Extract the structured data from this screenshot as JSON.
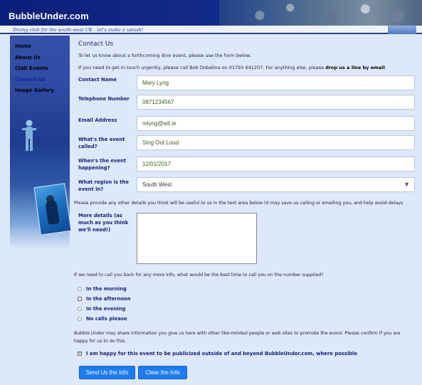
{
  "header": {
    "site_title": "BubbleUnder.com",
    "tagline": "Diving club for the south-west UK - let's make a splash!"
  },
  "sidebar": {
    "items": [
      {
        "label": "Home"
      },
      {
        "label": "About Us"
      },
      {
        "label": "Club Events"
      },
      {
        "label": "Contact Us",
        "active": true
      },
      {
        "label": "Image Gallery"
      }
    ]
  },
  "main": {
    "title": "Contact Us",
    "intro1": "To let us know about a forthcoming dive event, please use the form below.",
    "intro2_pre": "If you need to get in touch urgently, please call Bob Dobalina on 01793 641207. For anything else, please ",
    "intro2_bold": "drop us a line by email",
    "intro2_post": ".",
    "fields": {
      "contact_name": {
        "label": "Contact Name",
        "value": "Mary Lyng"
      },
      "phone": {
        "label": "Telephone Number",
        "value": "0871234567"
      },
      "email": {
        "label": "Email Address",
        "value": "mlyng@wit.ie"
      },
      "event_name": {
        "label": "What's the event called?",
        "value": "Sing Out Loud"
      },
      "event_date": {
        "label": "When's the event happening?",
        "value": "12/01/2017"
      },
      "region": {
        "label": "What region is the event in?",
        "value": "South West"
      }
    },
    "details_intro": "Please provide any other details you think will be useful to us in the text area below (it may save us calling or emailing you, and help avoid delays",
    "details_label": "More details (as much as you think we'll need!)",
    "details_value": "",
    "callback_question": "If we need to call you back for any more info, what would be the best time to call you on the number supplied?",
    "callback_options": [
      {
        "label": "In the morning",
        "selected": false
      },
      {
        "label": "In the afternoon",
        "selected": true
      },
      {
        "label": "In the evening",
        "selected": false
      },
      {
        "label": "No calls please",
        "selected": false
      }
    ],
    "share_text_line1": "Bubble Under may share information you give us here with other like-minded people or web sites to promote the event. Please confirm if you are",
    "share_text_line2": "happy for us to do this.",
    "publicize_label": "I am happy for this event to be publicized outside of and beyond BubbleUnder.com, where possible",
    "publicize_checked": true,
    "buttons": {
      "send": "Send Us the Info",
      "clear": "Clear the Info"
    }
  },
  "colors": {
    "accent": "#1d7cf2",
    "label": "#15237a",
    "header": "#0a1f7a",
    "background": "#dde8fb"
  }
}
